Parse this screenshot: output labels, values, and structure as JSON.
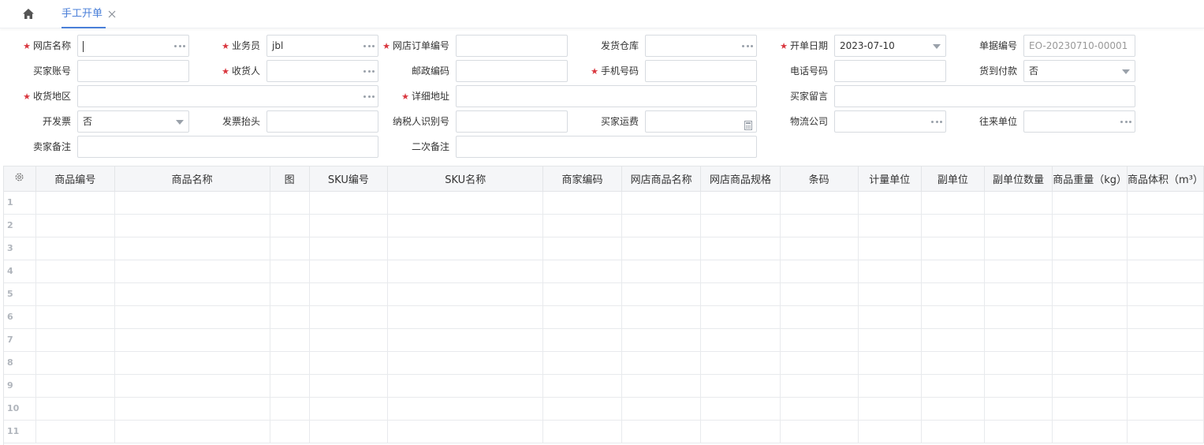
{
  "tabs": {
    "home_icon": "home-icon",
    "active_tab": "手工开单",
    "close_icon": "close-icon"
  },
  "form": {
    "shop_name": {
      "label": "网店名称",
      "value": ""
    },
    "salesperson": {
      "label": "业务员",
      "value": "jbl"
    },
    "shop_order_no": {
      "label": "网店订单编号",
      "value": ""
    },
    "ship_warehouse": {
      "label": "发货仓库",
      "value": ""
    },
    "order_date": {
      "label": "开单日期",
      "value": "2023-07-10"
    },
    "doc_no": {
      "label": "单据编号",
      "value": "EO-20230710-00001"
    },
    "buyer_account": {
      "label": "买家账号",
      "value": ""
    },
    "receiver": {
      "label": "收货人",
      "value": ""
    },
    "postal_code": {
      "label": "邮政编码",
      "value": ""
    },
    "mobile": {
      "label": "手机号码",
      "value": ""
    },
    "phone": {
      "label": "电话号码",
      "value": ""
    },
    "cod": {
      "label": "货到付款",
      "value": "否"
    },
    "ship_region": {
      "label": "收货地区",
      "value": ""
    },
    "address": {
      "label": "详细地址",
      "value": ""
    },
    "buyer_message": {
      "label": "买家留言",
      "value": ""
    },
    "invoice": {
      "label": "开发票",
      "value": "否"
    },
    "invoice_title": {
      "label": "发票抬头",
      "value": ""
    },
    "taxpayer_id": {
      "label": "纳税人识别号",
      "value": ""
    },
    "buyer_freight": {
      "label": "买家运费",
      "value": ""
    },
    "logistics": {
      "label": "物流公司",
      "value": ""
    },
    "partner": {
      "label": "往来单位",
      "value": ""
    },
    "seller_note": {
      "label": "卖家备注",
      "value": ""
    },
    "second_note": {
      "label": "二次备注",
      "value": ""
    }
  },
  "grid": {
    "settings_icon": "gear-icon",
    "columns": [
      "商品编号",
      "商品名称",
      "图",
      "SKU编号",
      "SKU名称",
      "商家编码",
      "网店商品名称",
      "网店商品规格",
      "条码",
      "计量单位",
      "副单位",
      "副单位数量",
      "商品重量（kg）",
      "商品体积（m³）"
    ],
    "rows": [
      "1",
      "2",
      "3",
      "4",
      "5",
      "6",
      "7",
      "8",
      "9",
      "10",
      "11"
    ]
  },
  "colors": {
    "accent": "#4a7fd8",
    "required": "#d9363e",
    "border": "#d7dbe0",
    "header_bg": "#f5f6f8"
  }
}
